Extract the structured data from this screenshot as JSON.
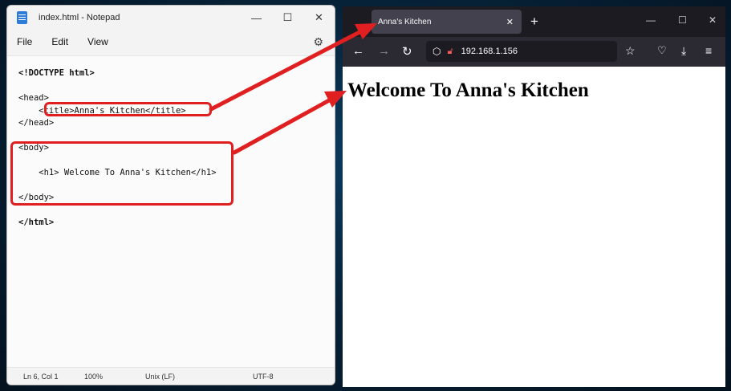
{
  "notepad": {
    "title": "index.html - Notepad",
    "window_controls": [
      "—",
      "☐",
      "✕"
    ],
    "menu": [
      "File",
      "Edit",
      "View"
    ],
    "settings_icon": "gear-icon",
    "code_lines": [
      "<!DOCTYPE html>",
      "",
      "<head>",
      "    <title>Anna's Kitchen</title>",
      "</head>",
      "",
      "<body>",
      "",
      "    <h1> Welcome To Anna's Kitchen</h1>",
      "",
      "</body>",
      "",
      "</html>"
    ],
    "status": {
      "position": "Ln 6, Col 1",
      "zoom": "100%",
      "line_ending": "Unix (LF)",
      "encoding": "UTF-8"
    }
  },
  "browser": {
    "tab_title": "Anna's Kitchen",
    "tab_close": "✕",
    "new_tab": "+",
    "window_controls": [
      "—",
      "☐",
      "✕"
    ],
    "url": "192.168.1.156",
    "page_heading": "Welcome To Anna's Kitchen"
  },
  "annotation_color": "#e02020"
}
